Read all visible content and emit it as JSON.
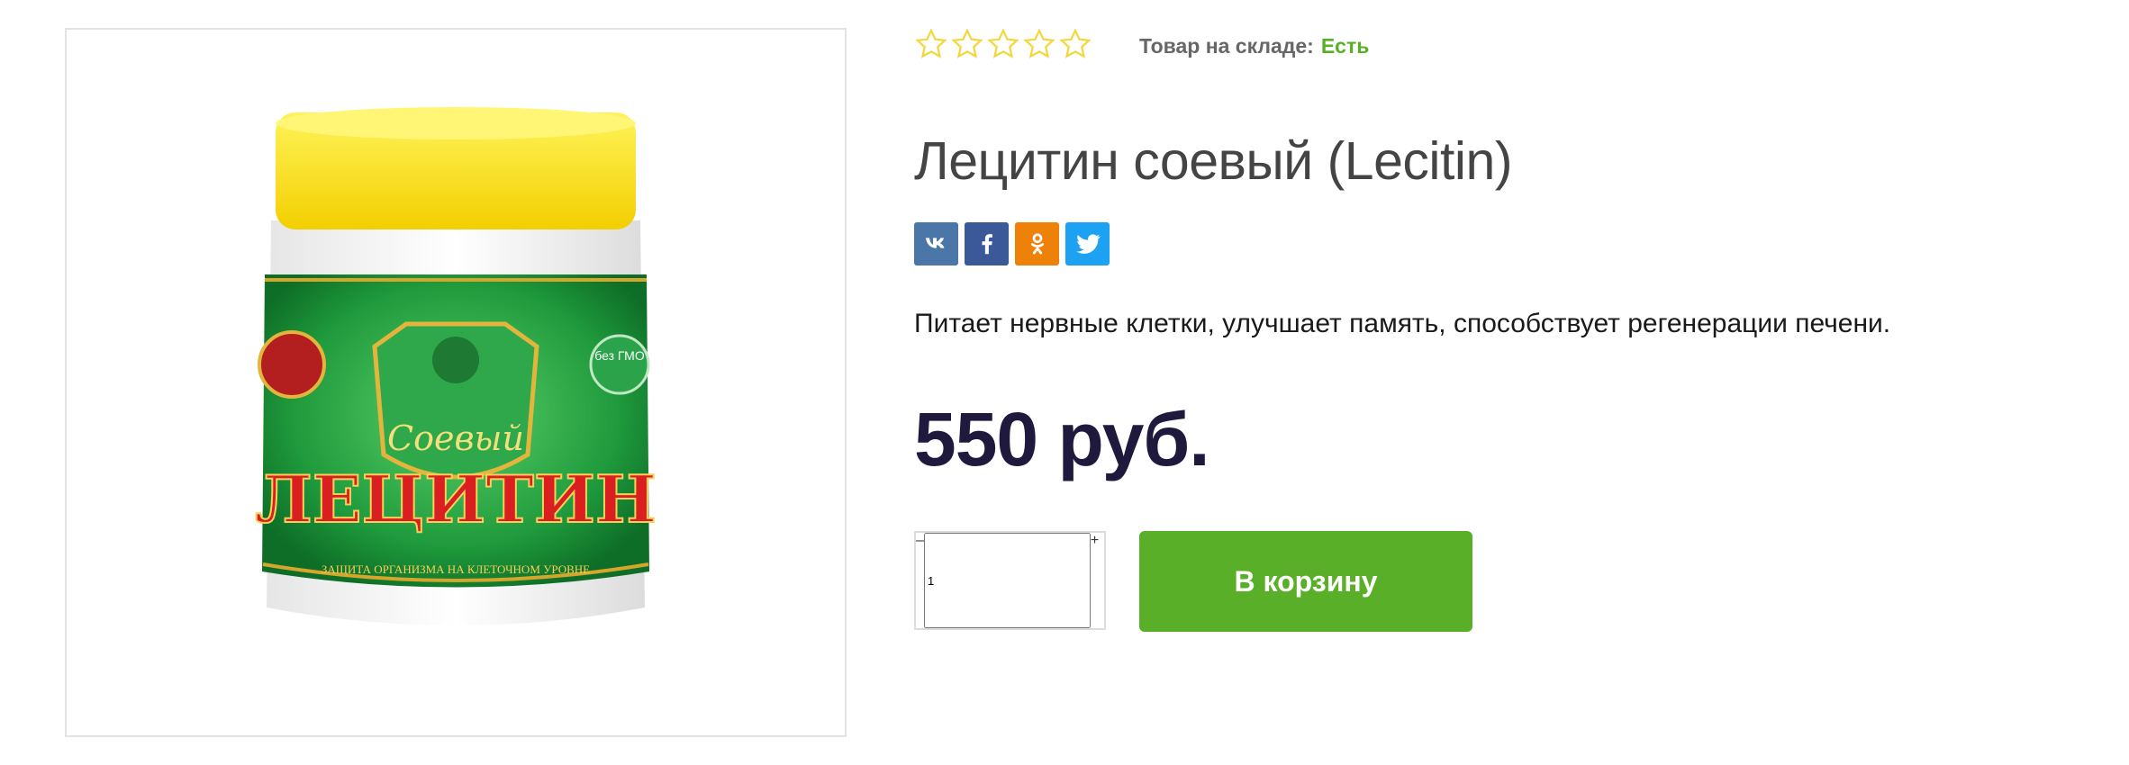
{
  "product": {
    "title": "Лецитин соевый (Lecitin)",
    "description": "Питает нервные клетки, улучшает память, способствует регенерации печени.",
    "price": "550 руб.",
    "rating": 0,
    "rating_max": 5
  },
  "stock": {
    "label": "Товар на складе:",
    "value": "Есть"
  },
  "jar": {
    "subtitle": "Соевый",
    "name": "ЛЕЦИТИН",
    "tagline": "ЗАЩИТА ОРГАНИЗМА НА КЛЕТОЧНОМ УРОВНЕ",
    "badge": "без ГМО"
  },
  "share": [
    {
      "name": "vk-share-button",
      "icon": "vk-icon",
      "color": "#4a76a8"
    },
    {
      "name": "facebook-share-button",
      "icon": "facebook-icon",
      "color": "#3b5998"
    },
    {
      "name": "odnoklassniki-share-button",
      "icon": "odnoklassniki-icon",
      "color": "#ee8208"
    },
    {
      "name": "twitter-share-button",
      "icon": "twitter-icon",
      "color": "#1da1f2"
    }
  ],
  "cart": {
    "quantity": "1",
    "minus_label": "–",
    "plus_label": "+",
    "add_label": "В корзину"
  },
  "colors": {
    "accent": "#5aaf28",
    "price": "#1f1a3d",
    "star": "#f3d73c"
  }
}
